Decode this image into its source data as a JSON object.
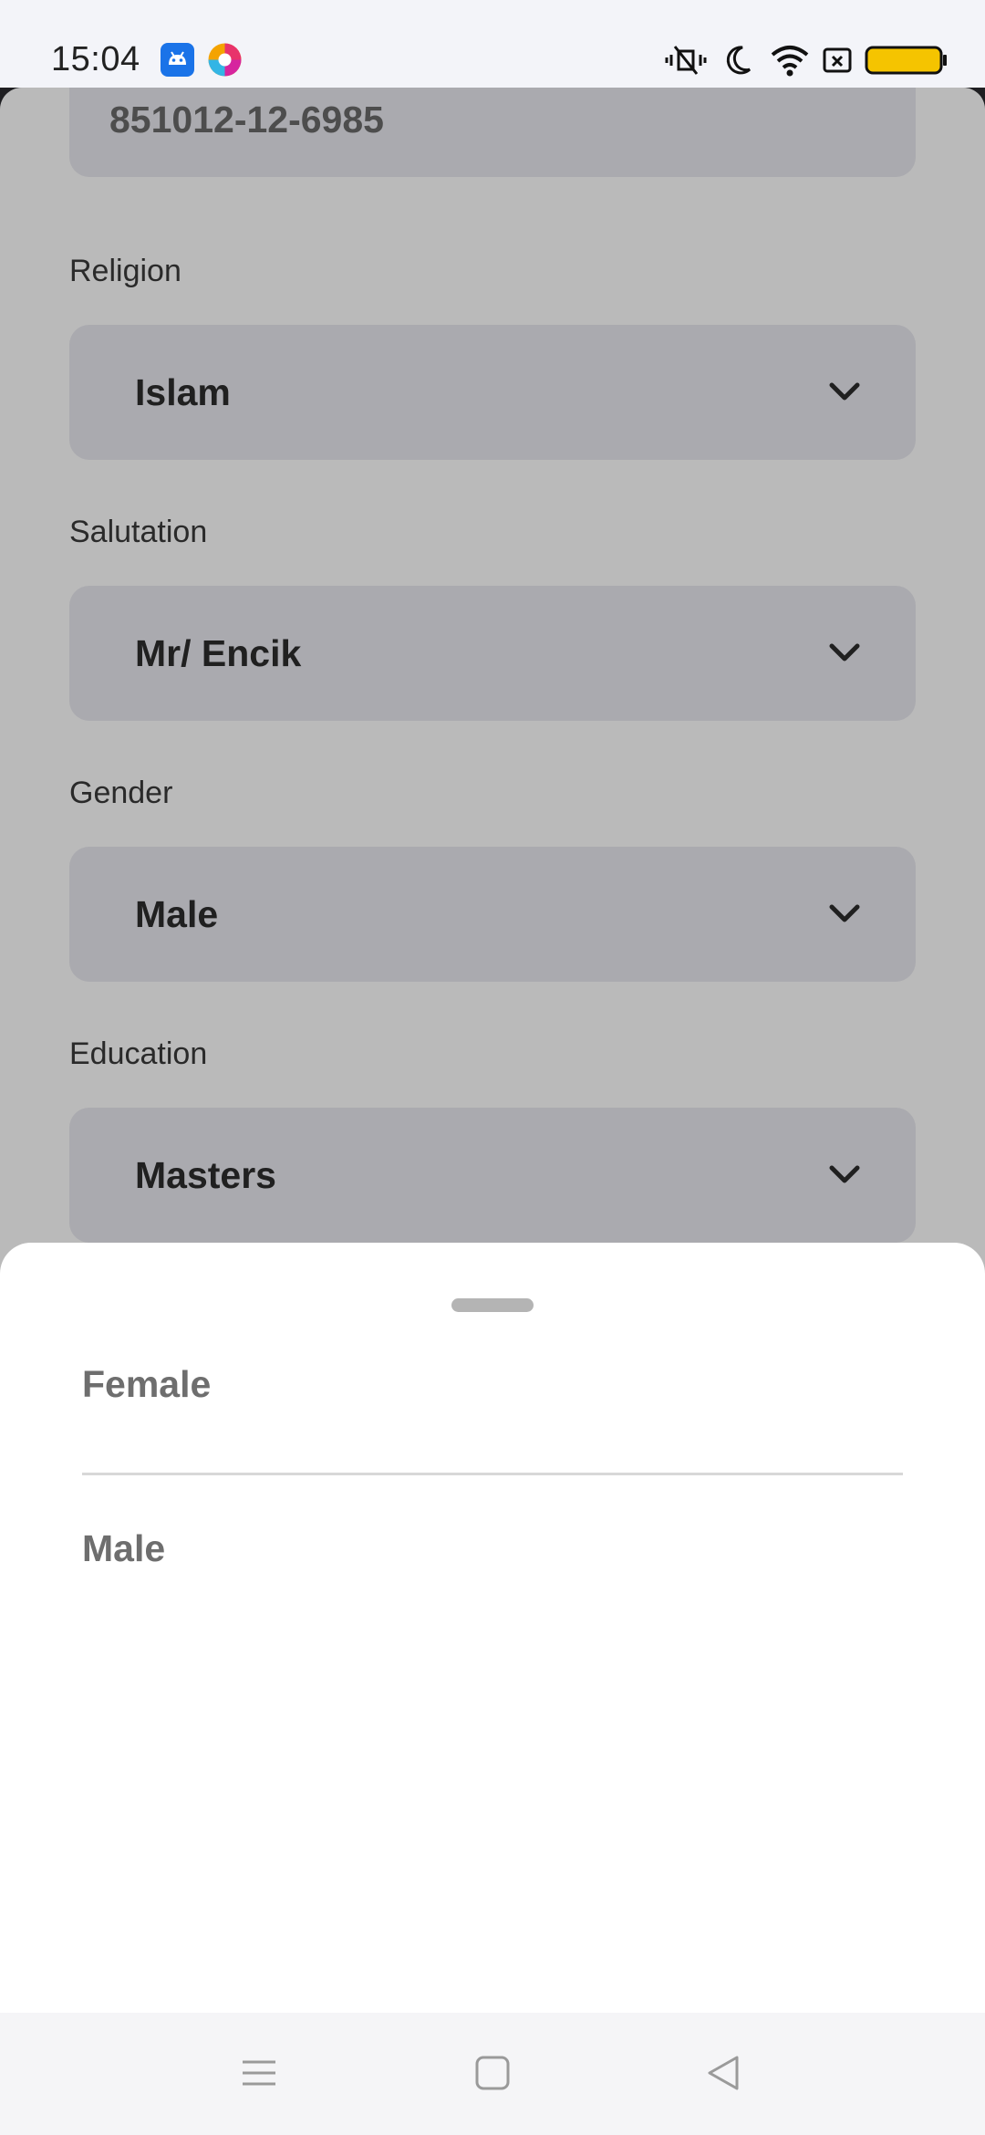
{
  "status_bar": {
    "time": "15:04",
    "icons": [
      "android-app-icon",
      "colorful-app-icon",
      "vibrate-off-icon",
      "do-not-disturb-moon-icon",
      "wifi-icon",
      "sim-icon",
      "battery-icon"
    ],
    "battery_color": "#f5c400"
  },
  "form": {
    "ic_number": "851012-12-6985",
    "religion": {
      "label": "Religion",
      "value": "Islam"
    },
    "salutation": {
      "label": "Salutation",
      "value": "Mr/ Encik"
    },
    "gender": {
      "label": "Gender",
      "value": "Male"
    },
    "education": {
      "label": "Education",
      "value": "Masters"
    }
  },
  "picker": {
    "options": [
      {
        "label": "Female"
      },
      {
        "label": "Male"
      }
    ]
  },
  "nav_bar": {
    "icons": [
      "menu-icon",
      "home-icon",
      "back-icon"
    ]
  }
}
